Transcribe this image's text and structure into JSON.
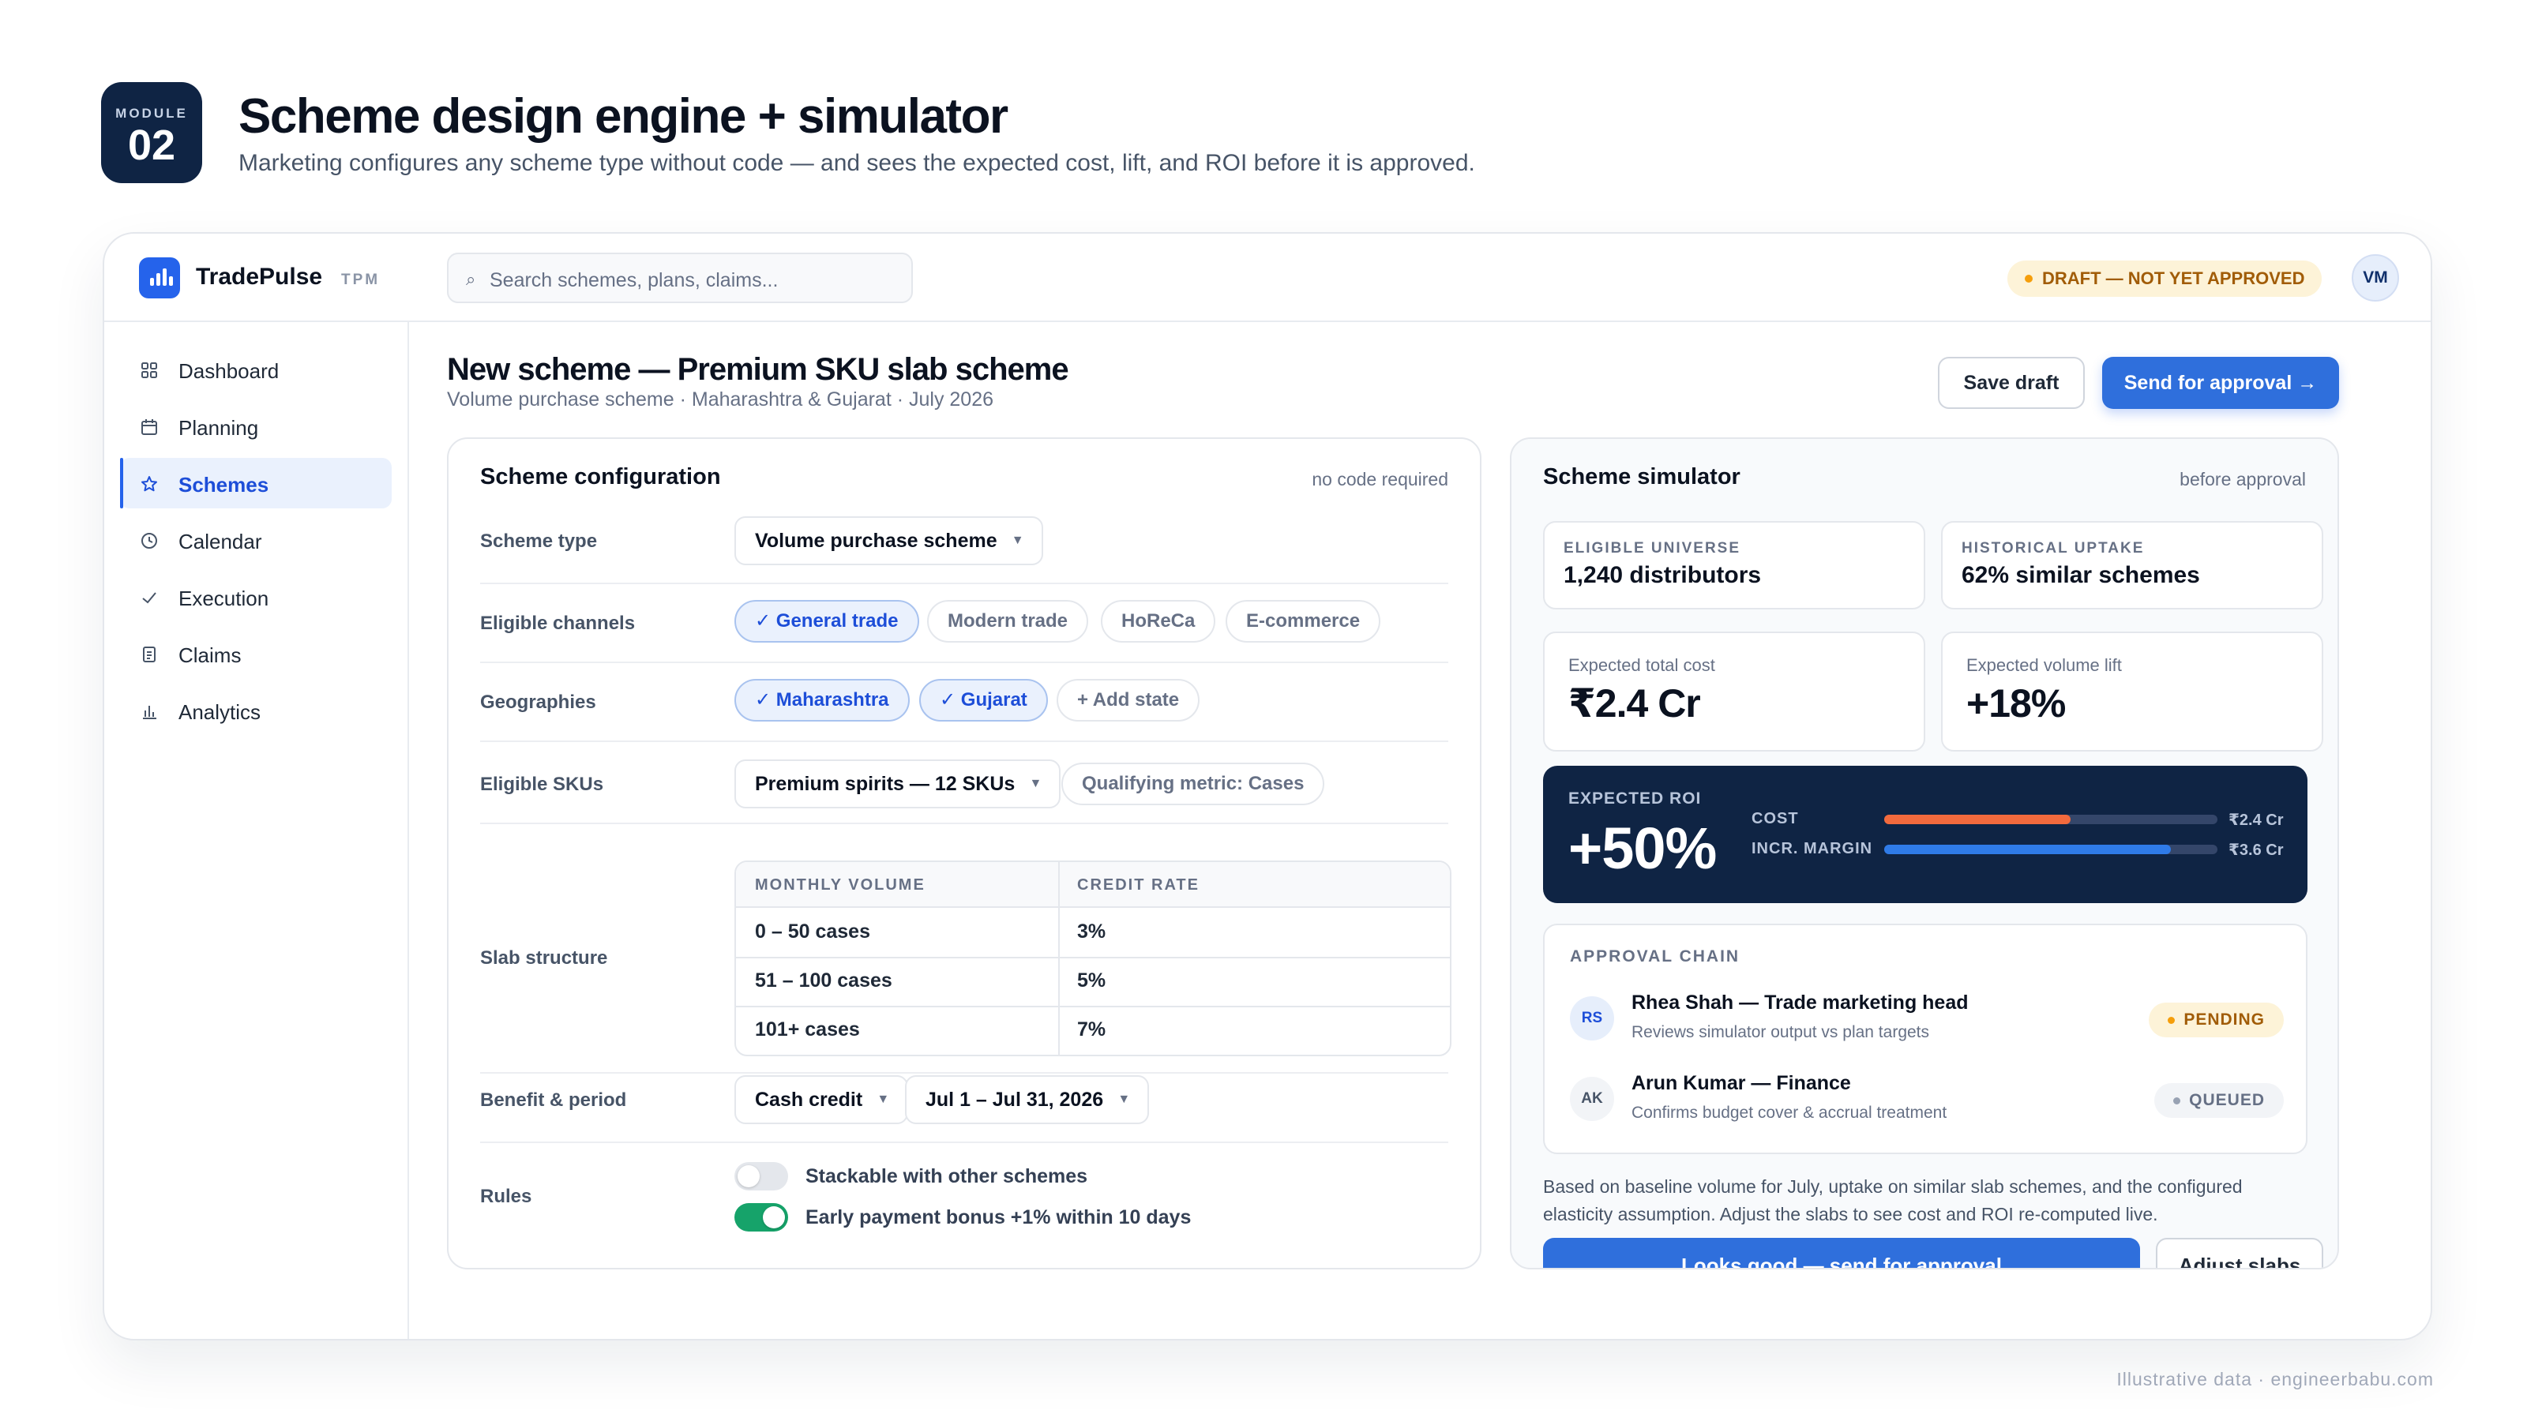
{
  "module": {
    "label": "MODULE",
    "number": "02"
  },
  "page": {
    "title": "Scheme design engine + simulator",
    "subtitle": "Marketing configures any scheme type without code — and sees the expected cost, lift, and ROI before it is approved."
  },
  "topbar": {
    "brand": "TradePulse",
    "brand_tag": "TPM",
    "search_placeholder": "Search schemes, plans, claims...",
    "status_badge": "DRAFT — NOT YET APPROVED",
    "user_initials": "VM"
  },
  "sidebar": {
    "items": [
      {
        "label": "Dashboard",
        "icon": "grid-icon",
        "active": false
      },
      {
        "label": "Planning",
        "icon": "calendar-icon",
        "active": false
      },
      {
        "label": "Schemes",
        "icon": "star-icon",
        "active": true
      },
      {
        "label": "Calendar",
        "icon": "clock-icon",
        "active": false
      },
      {
        "label": "Execution",
        "icon": "check-icon",
        "active": false
      },
      {
        "label": "Claims",
        "icon": "document-icon",
        "active": false
      },
      {
        "label": "Analytics",
        "icon": "bar-chart-icon",
        "active": false
      }
    ]
  },
  "main": {
    "title": "New scheme — Premium SKU slab scheme",
    "subtitle": "Volume purchase scheme · Maharashtra & Gujarat · July 2026",
    "save_draft_label": "Save draft",
    "send_label": "Send for approval →"
  },
  "config": {
    "title": "Scheme configuration",
    "meta": "no code required",
    "scheme_type_label": "Scheme type",
    "scheme_type_value": "Volume purchase scheme",
    "channels_label": "Eligible channels",
    "channels": [
      {
        "label": "✓ General trade",
        "selected": true
      },
      {
        "label": "Modern trade",
        "selected": false
      },
      {
        "label": "HoReCa",
        "selected": false
      },
      {
        "label": "E-commerce",
        "selected": false
      }
    ],
    "geographies_label": "Geographies",
    "geographies": [
      {
        "label": "✓ Maharashtra",
        "selected": true
      },
      {
        "label": "✓ Gujarat",
        "selected": true
      }
    ],
    "add_state_label": "+ Add state",
    "skus_label": "Eligible SKUs",
    "skus_value": "Premium spirits — 12 SKUs",
    "qualifying_metric": "Qualifying metric: Cases",
    "slab_label": "Slab structure",
    "slab_headers": [
      "MONTHLY VOLUME",
      "CREDIT RATE"
    ],
    "slabs": [
      {
        "volume": "0 – 50 cases",
        "rate": "3%"
      },
      {
        "volume": "51 – 100 cases",
        "rate": "5%"
      },
      {
        "volume": "101+ cases",
        "rate": "7%"
      }
    ],
    "benefit_label": "Benefit & period",
    "benefit_value": "Cash credit",
    "period_value": "Jul 1 – Jul 31, 2026",
    "rules_label": "Rules",
    "rules": [
      {
        "label": "Stackable with other schemes",
        "enabled": false
      },
      {
        "label": "Early payment bonus +1% within 10 days",
        "enabled": true
      }
    ]
  },
  "simulator": {
    "title": "Scheme simulator",
    "meta": "before approval",
    "eligible_universe_label": "ELIGIBLE UNIVERSE",
    "eligible_universe_value": "1,240 distributors",
    "historical_uptake_label": "HISTORICAL UPTAKE",
    "historical_uptake_value": "62% similar schemes",
    "expected_cost_label": "Expected total cost",
    "expected_cost_value": "₹2.4 Cr",
    "volume_lift_label": "Expected volume lift",
    "volume_lift_value": "+18%",
    "roi_label": "EXPECTED ROI",
    "roi_value": "+50%",
    "bars": [
      {
        "label": "COST",
        "value_label": "₹2.4 Cr",
        "fraction": 0.56,
        "color": "#f26a3d"
      },
      {
        "label": "INCR. MARGIN",
        "value_label": "₹3.6 Cr",
        "fraction": 0.86,
        "color": "#2f7be8"
      }
    ],
    "approval_title": "APPROVAL CHAIN",
    "approvers": [
      {
        "initials": "RS",
        "name": "Rhea Shah — Trade marketing head",
        "note": "Reviews simulator output vs plan targets",
        "status": "PENDING"
      },
      {
        "initials": "AK",
        "name": "Arun Kumar — Finance",
        "note": "Confirms budget cover & accrual treatment",
        "status": "QUEUED"
      }
    ],
    "note": "Based on baseline volume for July, uptake on similar slab schemes, and the configured elasticity assumption. Adjust the slabs to see cost and ROI re-computed live.",
    "looks_good_label": "Looks good — send for approval",
    "adjust_label": "Adjust slabs"
  },
  "footer": "Illustrative data · engineerbabu.com"
}
